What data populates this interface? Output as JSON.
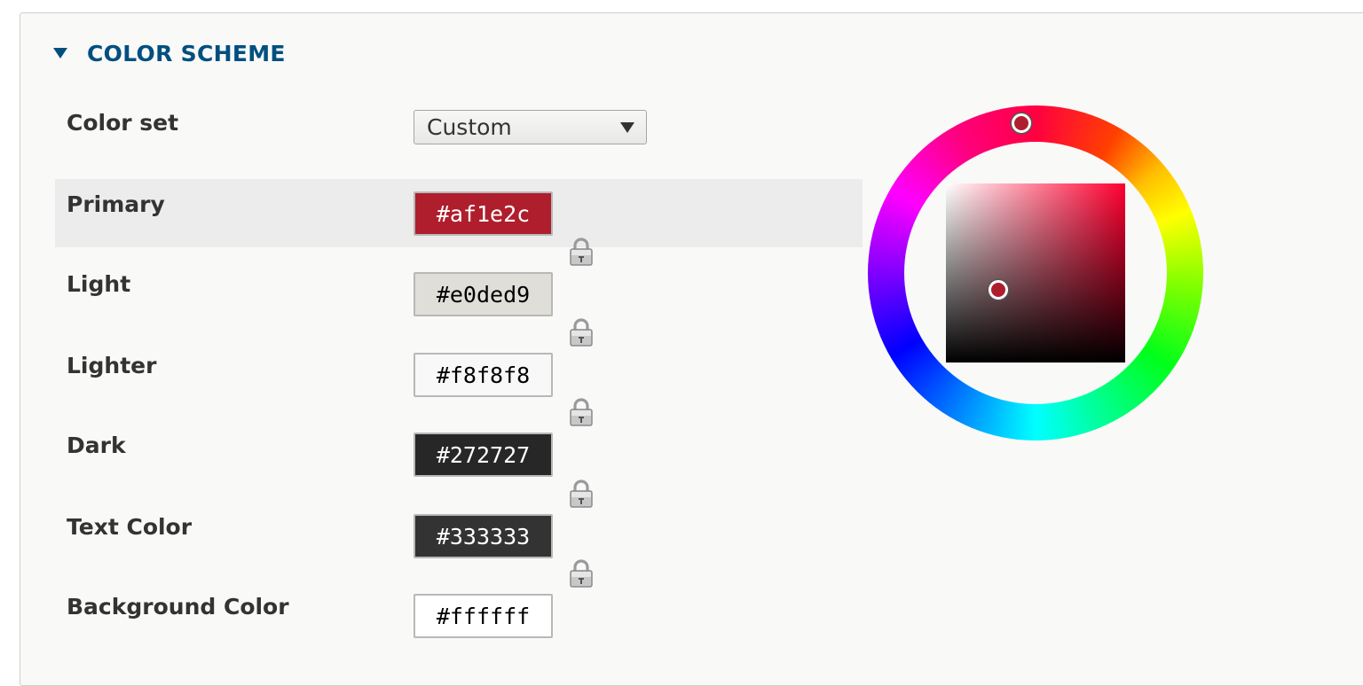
{
  "section": {
    "title": "COLOR SCHEME"
  },
  "color_set": {
    "label": "Color set",
    "selected": "Custom"
  },
  "fields": [
    {
      "label": "Primary",
      "value": "#af1e2c",
      "bg": "#af1e2c",
      "fg": "#ffffff"
    },
    {
      "label": "Light",
      "value": "#e0ded9",
      "bg": "#e0ded9",
      "fg": "#000000"
    },
    {
      "label": "Lighter",
      "value": "#f8f8f8",
      "bg": "#f8f8f8",
      "fg": "#000000"
    },
    {
      "label": "Dark",
      "value": "#272727",
      "bg": "#272727",
      "fg": "#ffffff"
    },
    {
      "label": "Text Color",
      "value": "#333333",
      "bg": "#333333",
      "fg": "#ffffff"
    },
    {
      "label": "Background Color",
      "value": "#ffffff",
      "bg": "#ffffff",
      "fg": "#000000"
    }
  ],
  "icons": {
    "lock": "lock-icon",
    "collapse": "triangle-down-icon"
  },
  "colors": {
    "accent": "#004f80",
    "active_row": "#ececec"
  }
}
